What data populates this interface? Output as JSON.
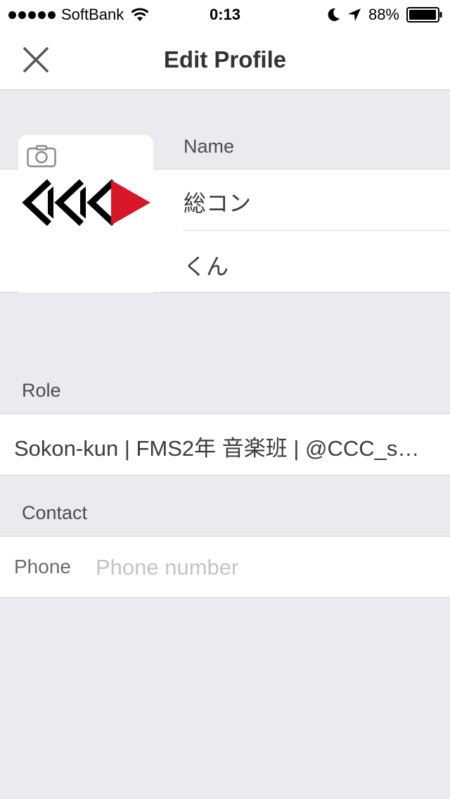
{
  "status_bar": {
    "carrier": "SoftBank",
    "time": "0:13",
    "battery": "88%",
    "icons": [
      "signal-dots",
      "wifi-icon",
      "moon-icon",
      "location-arrow-icon",
      "battery-icon"
    ]
  },
  "nav": {
    "title": "Edit Profile",
    "close_icon": "close-icon"
  },
  "name_section": {
    "label": "Name",
    "first_name": "総コン",
    "last_name": "くん"
  },
  "role_section": {
    "label": "Role",
    "value": "Sokon-kun | FMS2年 音楽班 | @CCC_s…"
  },
  "contact_section": {
    "label": "Contact",
    "phone_label": "Phone",
    "phone_value": "",
    "phone_placeholder": "Phone number"
  },
  "colors": {
    "background": "#ebebef",
    "logo_red": "#d7172a",
    "logo_black": "#000000"
  }
}
